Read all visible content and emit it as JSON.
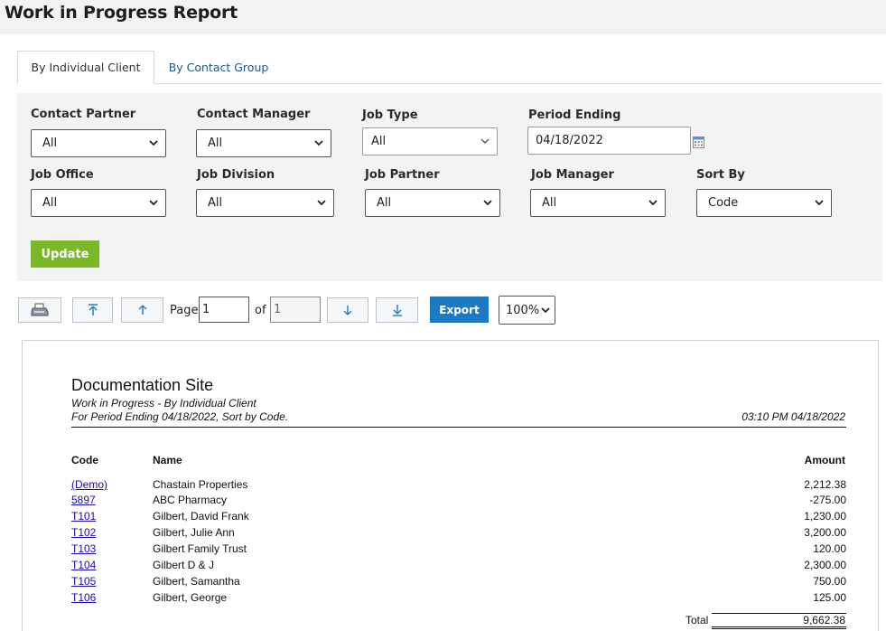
{
  "page_title": "Work in Progress Report",
  "tabs": [
    {
      "label": "By Individual Client",
      "active": true
    },
    {
      "label": "By Contact Group",
      "active": false
    }
  ],
  "filters": {
    "contact_partner": {
      "label": "Contact Partner",
      "value": "All"
    },
    "contact_manager": {
      "label": "Contact Manager",
      "value": "All"
    },
    "job_type": {
      "label": "Job Type",
      "value": "All"
    },
    "period_ending": {
      "label": "Period Ending",
      "value": "04/18/2022"
    },
    "job_office": {
      "label": "Job Office",
      "value": "All"
    },
    "job_division": {
      "label": "Job Division",
      "value": "All"
    },
    "job_partner": {
      "label": "Job Partner",
      "value": "All"
    },
    "job_manager": {
      "label": "Job Manager",
      "value": "All"
    },
    "sort_by": {
      "label": "Sort By",
      "value": "Code"
    }
  },
  "update_label": "Update",
  "toolbar": {
    "page_label": "Page",
    "page_value": "1",
    "of_label": "of",
    "of_value": "1",
    "export_label": "Export",
    "zoom_value": "100%"
  },
  "report": {
    "site": "Documentation Site",
    "subtitle": "Work in Progress - By Individual Client",
    "period_line": "For Period Ending 04/18/2022, Sort by Code.",
    "timestamp": "03:10 PM 04/18/2022",
    "columns": {
      "code": "Code",
      "name": "Name",
      "amount": "Amount"
    },
    "rows": [
      {
        "code": "(Demo)",
        "name": "Chastain Properties",
        "amount": "2,212.38"
      },
      {
        "code": "5897",
        "name": "ABC Pharmacy",
        "amount": "-275.00"
      },
      {
        "code": "T101",
        "name": "Gilbert, David Frank",
        "amount": "1,230.00"
      },
      {
        "code": "T102",
        "name": "Gilbert, Julie Ann",
        "amount": "3,200.00"
      },
      {
        "code": "T103",
        "name": "Gilbert Family Trust",
        "amount": "120.00"
      },
      {
        "code": "T104",
        "name": "Gilbert D & J",
        "amount": "2,300.00"
      },
      {
        "code": "T105",
        "name": "Gilbert, Samantha",
        "amount": "750.00"
      },
      {
        "code": "T106",
        "name": "Gilbert, George",
        "amount": "125.00"
      }
    ],
    "total_label": "Total",
    "total_value": "9,662.38"
  },
  "colors": {
    "update_green": "#7ab828",
    "export_blue": "#1b7ac1",
    "link_blue": "#1a0dab",
    "tab_link": "#1a5a8a"
  },
  "icons": [
    "printer-icon",
    "first-page-icon",
    "previous-page-icon",
    "next-page-icon",
    "last-page-icon",
    "calendar-icon",
    "chevron-down-icon"
  ]
}
